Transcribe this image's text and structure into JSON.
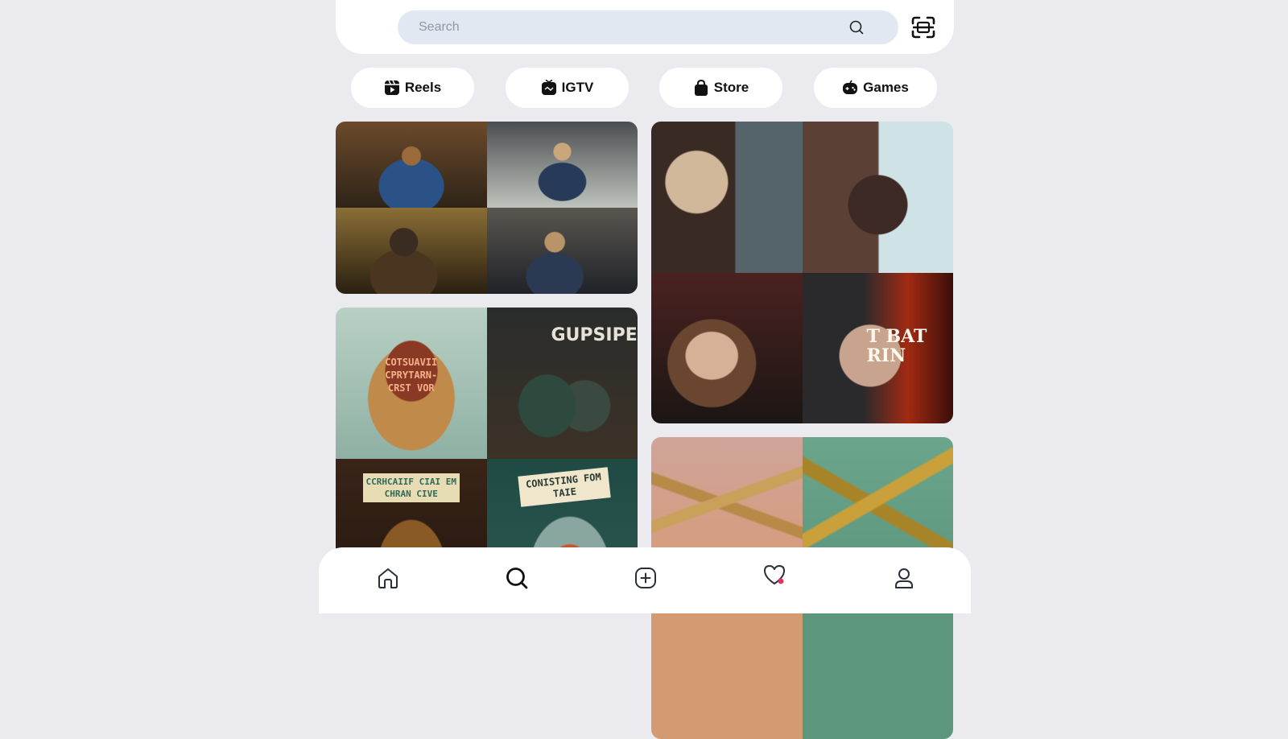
{
  "search": {
    "placeholder": "Search"
  },
  "header": {
    "scan_icon": "scan-icon",
    "search_icon": "search-icon"
  },
  "categories": [
    {
      "label": "Reels",
      "icon": "reels-icon"
    },
    {
      "label": "IGTV",
      "icon": "tv-icon"
    },
    {
      "label": "Store",
      "icon": "shopping-bag-icon"
    },
    {
      "label": "Games",
      "icon": "gamepad-icon"
    }
  ],
  "tiles": [
    {
      "captions": []
    },
    {
      "captions": [
        "T BAT RIN"
      ]
    },
    {
      "captions": [
        "COTSUAVII CPRYTARN- CRST VOR",
        "GUPSIPE",
        "CCRHCAIIF CIAI EM CHRAN CIVE",
        "CONISTING FOM TAIE"
      ]
    },
    {
      "captions": []
    }
  ],
  "bottom_nav": [
    {
      "icon": "home-icon"
    },
    {
      "icon": "search-icon",
      "active": true
    },
    {
      "icon": "add-post-icon"
    },
    {
      "icon": "heart-icon",
      "notification_dot": true
    },
    {
      "icon": "profile-icon"
    }
  ],
  "colors": {
    "page_bg": "#ebebef",
    "search_bg": "#e1e8f1",
    "notification_dot": "#e8305a"
  }
}
